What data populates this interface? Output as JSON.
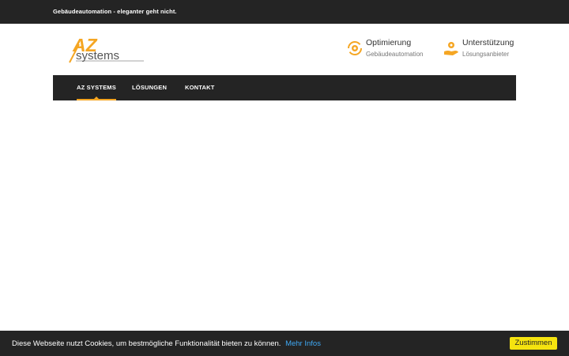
{
  "topbar": {
    "tagline": "Gebäudeautomation - eleganter geht nicht."
  },
  "logo": {
    "mark": "AZ",
    "word": "systems"
  },
  "features": [
    {
      "title": "Optimierung",
      "subtitle": "Gebäudeautomation",
      "icon": "gear-cycle-icon"
    },
    {
      "title": "Unterstützung",
      "subtitle": "Lösungsanbieter",
      "icon": "hand-gear-icon"
    }
  ],
  "nav": {
    "items": [
      {
        "label": "AZ SYSTEMS",
        "active": true
      },
      {
        "label": "LÖSUNGEN",
        "active": false
      },
      {
        "label": "KONTAKT",
        "active": false
      }
    ]
  },
  "cookie": {
    "message": "Diese Webseite nutzt Cookies, um bestmögliche Funktionalität bieten zu können.",
    "link": "Mehr Infos",
    "button": "Zustimmen"
  },
  "colors": {
    "accent": "#f5a623",
    "dark": "#242424",
    "cookie_button": "#f5e30f",
    "link": "#3fa9f5"
  }
}
